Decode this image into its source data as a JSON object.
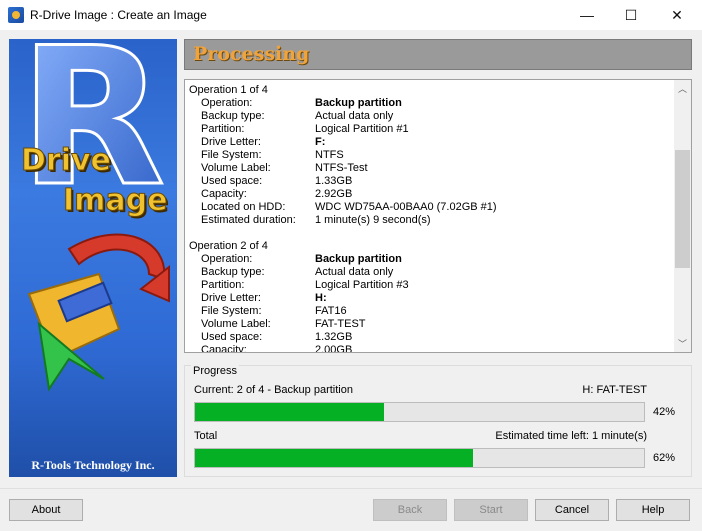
{
  "window": {
    "title": "R-Drive Image : Create an Image",
    "minimize_glyph": "—",
    "maximize_glyph": "☐",
    "close_glyph": "✕"
  },
  "banner": {
    "logo_letter": "R",
    "logo_word1": "Drive",
    "logo_word2": "Image",
    "footer": "R-Tools Technology Inc."
  },
  "header": {
    "title": "Processing"
  },
  "operations": [
    {
      "title": "Operation 1 of 4",
      "rows": [
        {
          "key": "Operation:",
          "value": "Backup partition",
          "bold": true
        },
        {
          "key": "Backup type:",
          "value": "Actual data only"
        },
        {
          "key": "Partition:",
          "value": "Logical Partition #1"
        },
        {
          "key": "Drive Letter:",
          "value": "F:",
          "bold": true
        },
        {
          "key": "File System:",
          "value": "NTFS"
        },
        {
          "key": "Volume Label:",
          "value": "NTFS-Test"
        },
        {
          "key": "Used space:",
          "value": "1.33GB"
        },
        {
          "key": "Capacity:",
          "value": "2.92GB"
        },
        {
          "key": "Located on HDD:",
          "value": "WDC WD75AA-00BAA0 (7.02GB #1)"
        },
        {
          "key": "Estimated duration:",
          "value": "1 minute(s) 9 second(s)"
        }
      ]
    },
    {
      "title": "Operation 2 of 4",
      "rows": [
        {
          "key": "Operation:",
          "value": "Backup partition",
          "bold": true
        },
        {
          "key": "Backup type:",
          "value": "Actual data only"
        },
        {
          "key": "Partition:",
          "value": "Logical Partition #3"
        },
        {
          "key": "Drive Letter:",
          "value": "H:",
          "bold": true
        },
        {
          "key": "File System:",
          "value": "FAT16"
        },
        {
          "key": "Volume Label:",
          "value": "FAT-TEST"
        },
        {
          "key": "Used space:",
          "value": "1.32GB"
        },
        {
          "key": "Capacity:",
          "value": "2.00GB"
        }
      ]
    }
  ],
  "progress": {
    "group_label": "Progress",
    "current_text": "Current: 2 of 4 - Backup partition",
    "current_target": "H: FAT-TEST",
    "current_percent": 42,
    "current_percent_label": "42%",
    "total_label": "Total",
    "eta_text": "Estimated time left: 1 minute(s)",
    "total_percent": 62,
    "total_percent_label": "62%",
    "bar_color": "#06b025"
  },
  "buttons": {
    "about": "About",
    "back": "Back",
    "start": "Start",
    "cancel": "Cancel",
    "help": "Help"
  }
}
